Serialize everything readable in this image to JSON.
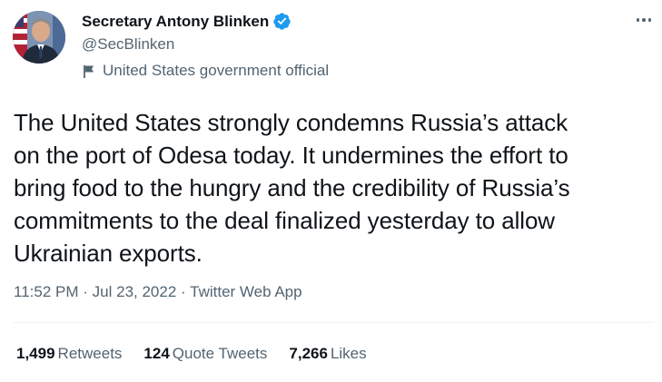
{
  "author": {
    "name": "Secretary Antony Blinken",
    "handle": "@SecBlinken",
    "label": "United States government official",
    "verified": true
  },
  "tweet": {
    "lines": [
      "The United States strongly condemns Russia’s attack",
      "on the port of Odesa today. It undermines the effort to",
      "bring food to the hungry and the credibility of Russia’s",
      "commitments to the deal finalized yesterday to allow",
      "Ukrainian exports."
    ],
    "time": "11:52 PM",
    "separator": "·",
    "date": "Jul 23, 2022",
    "source": "Twitter Web App"
  },
  "stats": {
    "retweets_count": "1,499",
    "retweets_label": "Retweets",
    "quotes_count": "124",
    "quotes_label": "Quote Tweets",
    "likes_count": "7,266",
    "likes_label": "Likes"
  },
  "colors": {
    "text": "#0f1419",
    "secondary": "#536471",
    "verified": "#1d9bf0",
    "divider": "#eff3f4"
  },
  "icons": {
    "verified": "verified-badge-icon",
    "label": "flag-icon",
    "more": "more-icon"
  }
}
